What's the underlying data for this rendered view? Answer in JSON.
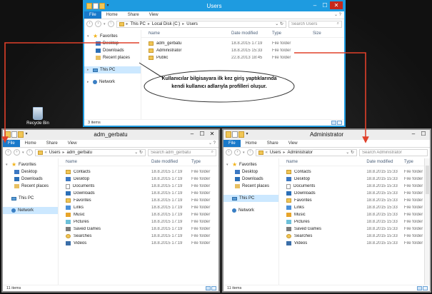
{
  "desktop": {
    "recycle_bin_label": "Recycle Bin",
    "annotation_line1": "Kullanıcılar bilgisayara ilk kez giriş yaptıklarında",
    "annotation_line2": "kendi kullanıcı adlarıyla profilleri oluşur.",
    "arrow_color": "#e0402a"
  },
  "ribbon": {
    "tab_file": "File",
    "tab_home": "Home",
    "tab_share": "Share",
    "tab_view": "View"
  },
  "nav": {
    "favorites": "Favorites",
    "desktop": "Desktop",
    "downloads": "Downloads",
    "recent_places": "Recent places",
    "this_pc": "This PC",
    "network": "Network"
  },
  "columns": {
    "name": "Name",
    "date_modified": "Date modified",
    "type": "Type",
    "size": "Size"
  },
  "users_window": {
    "title": "Users",
    "path": [
      "This PC",
      "Local Disk (C:)",
      "Users"
    ],
    "search_placeholder": "Search Users",
    "status": "3 items",
    "rows": [
      {
        "name": "adm_gerbatu",
        "date": "18.8.2015 17:19",
        "type": "File folder"
      },
      {
        "name": "Administrator",
        "date": "18.8.2015 15:33",
        "type": "File folder"
      },
      {
        "name": "Public",
        "date": "22.8.2013 18:45",
        "type": "File folder"
      }
    ]
  },
  "adm_window": {
    "title": "adm_gerbatu",
    "path_prefix": "«",
    "path": [
      "Users",
      "adm_gerbatu"
    ],
    "search_placeholder": "Search adm_gerbatu",
    "status": "11 items",
    "rows": [
      {
        "name": "Contacts",
        "date": "18.8.2015 17:19",
        "type": "File folder",
        "icon": "contacts"
      },
      {
        "name": "Desktop",
        "date": "18.8.2015 17:19",
        "type": "File folder",
        "icon": "desk"
      },
      {
        "name": "Documents",
        "date": "18.8.2015 17:19",
        "type": "File folder",
        "icon": "doc"
      },
      {
        "name": "Downloads",
        "date": "18.8.2015 17:19",
        "type": "File folder",
        "icon": "dl"
      },
      {
        "name": "Favorites",
        "date": "18.8.2015 17:19",
        "type": "File folder",
        "icon": "star"
      },
      {
        "name": "Links",
        "date": "18.8.2015 17:19",
        "type": "File folder",
        "icon": "link"
      },
      {
        "name": "Music",
        "date": "18.8.2015 17:19",
        "type": "File folder",
        "icon": "music"
      },
      {
        "name": "Pictures",
        "date": "18.8.2015 17:19",
        "type": "File folder",
        "icon": "pic"
      },
      {
        "name": "Saved Games",
        "date": "18.8.2015 17:19",
        "type": "File folder",
        "icon": "game"
      },
      {
        "name": "Searches",
        "date": "18.8.2015 17:19",
        "type": "File folder",
        "icon": "search2"
      },
      {
        "name": "Videos",
        "date": "18.8.2015 17:19",
        "type": "File folder",
        "icon": "vid"
      }
    ]
  },
  "admin_window": {
    "title": "Administrator",
    "path_prefix": "«",
    "path": [
      "Users",
      "Administrator"
    ],
    "search_placeholder": "Search Administrator",
    "status": "11 items",
    "rows": [
      {
        "name": "Contacts",
        "date": "18.8.2015 15:33",
        "type": "File folder",
        "icon": "contacts"
      },
      {
        "name": "Desktop",
        "date": "18.8.2015 15:33",
        "type": "File folder",
        "icon": "desk"
      },
      {
        "name": "Documents",
        "date": "18.8.2015 15:33",
        "type": "File folder",
        "icon": "doc"
      },
      {
        "name": "Downloads",
        "date": "18.8.2015 15:33",
        "type": "File folder",
        "icon": "dl"
      },
      {
        "name": "Favorites",
        "date": "18.8.2015 15:33",
        "type": "File folder",
        "icon": "star"
      },
      {
        "name": "Links",
        "date": "18.8.2015 15:33",
        "type": "File folder",
        "icon": "link"
      },
      {
        "name": "Music",
        "date": "18.8.2015 15:33",
        "type": "File folder",
        "icon": "music"
      },
      {
        "name": "Pictures",
        "date": "18.8.2015 15:33",
        "type": "File folder",
        "icon": "pic"
      },
      {
        "name": "Saved Games",
        "date": "18.8.2015 15:33",
        "type": "File folder",
        "icon": "game"
      },
      {
        "name": "Searches",
        "date": "18.8.2015 15:33",
        "type": "File folder",
        "icon": "search2"
      },
      {
        "name": "Videos",
        "date": "18.8.2015 15:33",
        "type": "File folder",
        "icon": "vid"
      }
    ]
  }
}
